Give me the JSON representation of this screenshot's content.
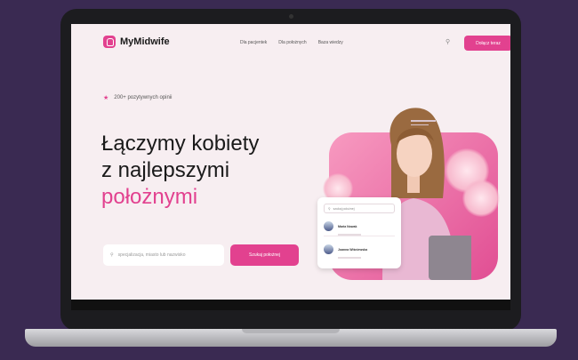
{
  "app": {
    "logo_text": "MyMidwife"
  },
  "nav": {
    "links": [
      "Dla pacjentek",
      "Dla położnych",
      "Baza wiedzy"
    ],
    "cta_label": "Dołącz teraz"
  },
  "hero": {
    "rating_text": "200+ pozytywnych opinii",
    "headline_line1": "Łączymy kobiety",
    "headline_line2": "z najlepszymi",
    "headline_line3": "położnymi",
    "search_placeholder": "specjalizacja, miasto lub nazwisko",
    "search_button": "Szukaj położnej"
  },
  "card": {
    "search_text": "szukaj położnej",
    "midwives": [
      "Maria Nowak",
      "Joanna Wiśniewska"
    ]
  },
  "colors": {
    "accent": "#e2418f",
    "background": "#3a2a52"
  }
}
